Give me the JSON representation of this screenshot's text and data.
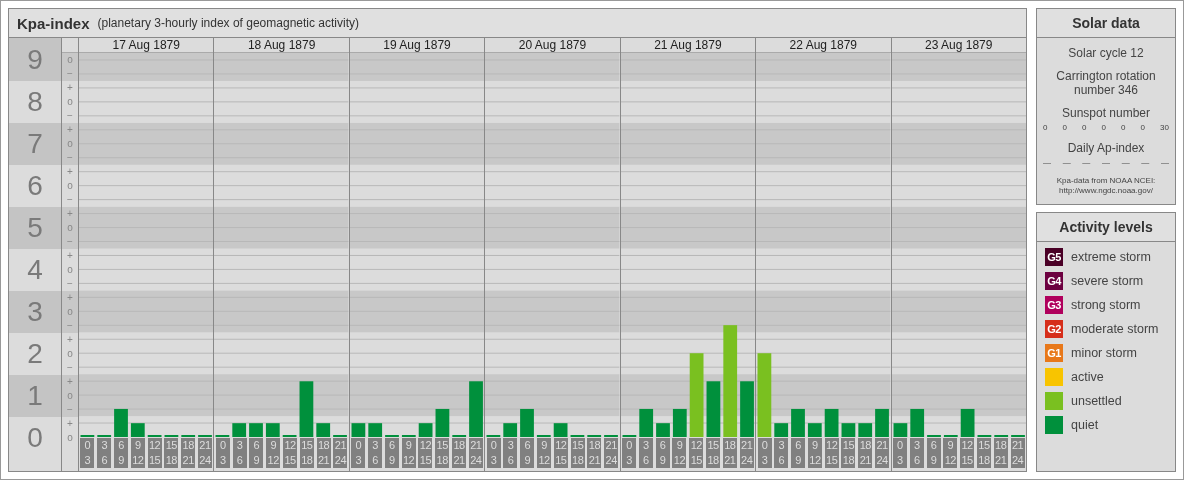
{
  "kp_panel": {
    "subtitle": "(planetary 3-hourly index of geomagnetic activity)",
    "y_marks": [
      [
        "o",
        "−"
      ],
      [
        "+",
        "o",
        "−"
      ],
      [
        "+",
        "o",
        "−"
      ],
      [
        "+",
        "o",
        "−"
      ],
      [
        "+",
        "o",
        "−"
      ],
      [
        "+",
        "o",
        "−"
      ],
      [
        "+",
        "o",
        "−"
      ],
      [
        "+",
        "o",
        "−"
      ],
      [
        "+",
        "o",
        "−"
      ],
      [
        "+",
        "o"
      ]
    ],
    "days": [
      {
        "date": "17 Aug 1879"
      },
      {
        "date": "18 Aug 1879"
      },
      {
        "date": "19 Aug 1879"
      },
      {
        "date": "20 Aug 1879"
      },
      {
        "date": "21 Aug 1879"
      },
      {
        "date": "22 Aug 1879"
      },
      {
        "date": "23 Aug 1879"
      }
    ],
    "chart_data": {
      "type": "bar",
      "title": "Kpa-index",
      "grid": true,
      "ylim": [
        0,
        9
      ],
      "yticks": [
        0,
        1,
        2,
        3,
        4,
        5,
        6,
        7,
        8,
        9
      ],
      "categories": [
        "0 3",
        "3 6",
        "6 9",
        "9 12",
        "12 15",
        "15 18",
        "18 21",
        "21 24",
        "0 3",
        "3 6",
        "6 9",
        "9 12",
        "12 15",
        "15 18",
        "18 21",
        "21 24",
        "0 3",
        "3 6",
        "6 9",
        "9 12",
        "12 15",
        "15 18",
        "18 21",
        "21 24",
        "0 3",
        "3 6",
        "6 9",
        "9 12",
        "12 15",
        "15 18",
        "18 21",
        "21 24",
        "0 3",
        "3 6",
        "6 9",
        "9 12",
        "12 15",
        "15 18",
        "18 21",
        "21 24",
        "0 3",
        "3 6",
        "6 9",
        "9 12",
        "12 15",
        "15 18",
        "18 21",
        "21 24",
        "0 3",
        "3 6",
        "6 9",
        "9 12",
        "12 15",
        "15 18",
        "18 21",
        "21 24"
      ],
      "values": [
        0,
        0,
        0.67,
        0.33,
        0,
        0,
        0,
        0,
        0,
        0.33,
        0.33,
        0.33,
        0,
        1.33,
        0.33,
        0,
        0.33,
        0.33,
        0,
        0,
        0.33,
        0.67,
        0,
        1.33,
        0,
        0.33,
        0.67,
        0,
        0.33,
        0,
        0,
        0,
        0,
        0.67,
        0.33,
        0.67,
        2,
        1.33,
        2.67,
        1.33,
        2,
        0.33,
        0.67,
        0.33,
        0.67,
        0.33,
        0.33,
        0.67,
        0.33,
        0.67,
        0,
        0,
        0.67,
        0,
        0,
        0
      ]
    }
  },
  "solar_data": {
    "title": "Solar data",
    "solar_cycle": "Solar cycle 12",
    "carrington": "Carrington rotation number 346",
    "sunspot_title": "Sunspot number",
    "sunspot_numbers": [
      "0",
      "0",
      "0",
      "0",
      "0",
      "0",
      "30"
    ],
    "ap_title": "Daily Ap-index",
    "ap_values": [
      "—",
      "—",
      "—",
      "—",
      "—",
      "—",
      "—"
    ],
    "source": "Kpa-data from NOAA NCEI:",
    "source_url": "http://www.ngdc.noaa.gov/"
  },
  "activity_levels": {
    "title": "Activity levels",
    "items": [
      {
        "badge": "G5",
        "label": "extreme storm",
        "color": "#4a0026"
      },
      {
        "badge": "G4",
        "label": "severe storm",
        "color": "#6c0040"
      },
      {
        "badge": "G3",
        "label": "strong storm",
        "color": "#b0005c"
      },
      {
        "badge": "G2",
        "label": "moderate storm",
        "color": "#d62e1a"
      },
      {
        "badge": "G1",
        "label": "minor storm",
        "color": "#e8781a"
      },
      {
        "label": "active",
        "color": "#f8c400"
      },
      {
        "label": "unsettled",
        "color": "#7ac020"
      },
      {
        "label": "quiet",
        "color": "#00903c"
      }
    ]
  }
}
